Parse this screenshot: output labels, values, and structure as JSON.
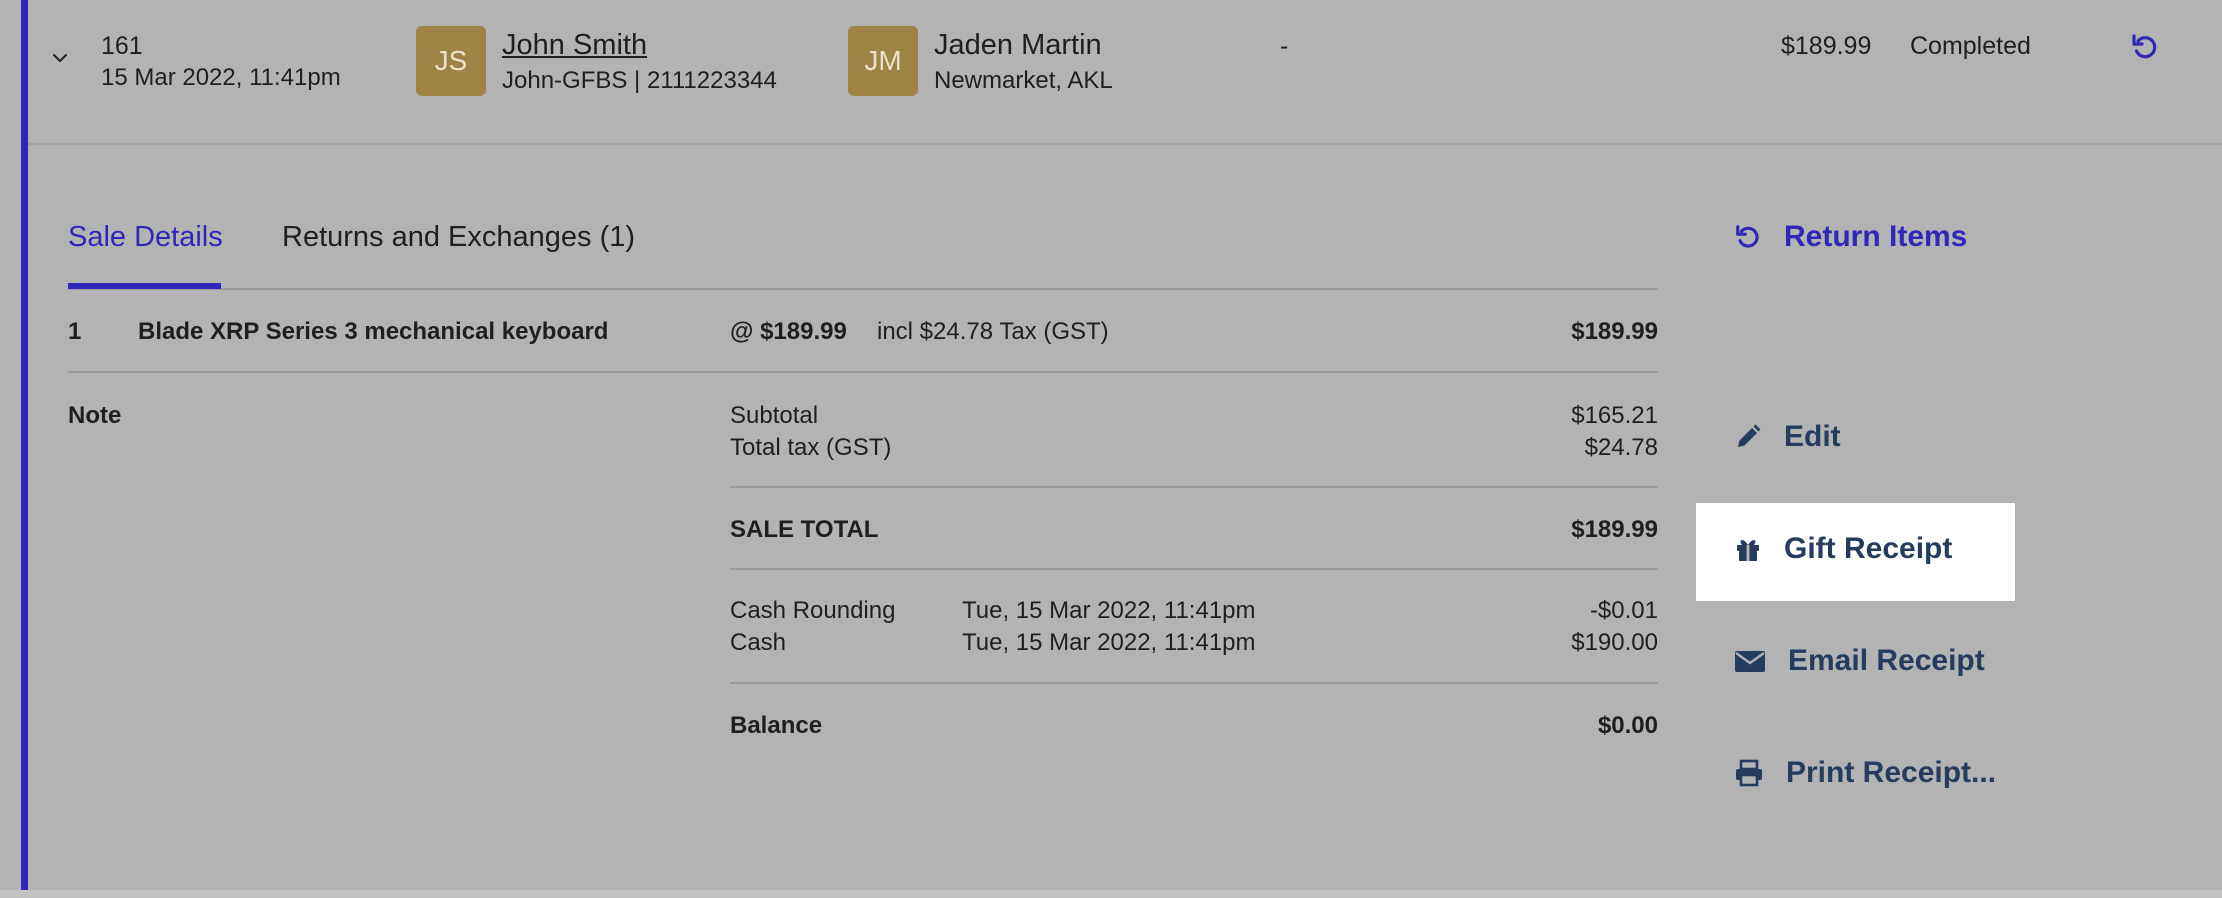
{
  "row": {
    "sale_number": "161",
    "sale_date": "15 Mar 2022, 11:41pm",
    "customer": {
      "initials": "JS",
      "name": "John Smith",
      "sub": "John-GFBS | 2111223344"
    },
    "staff": {
      "initials": "JM",
      "name": "Jaden Martin",
      "sub": "Newmarket, AKL"
    },
    "note_dash": "-",
    "amount": "$189.99",
    "status": "Completed"
  },
  "tabs": [
    {
      "label": "Sale Details",
      "active": true
    },
    {
      "label": "Returns and Exchanges (1)",
      "active": false
    }
  ],
  "line_item": {
    "qty": "1",
    "name": "Blade XRP Series 3 mechanical keyboard",
    "unit_price": "@ $189.99",
    "tax_note": "incl $24.78 Tax (GST)",
    "total": "$189.99"
  },
  "note_label": "Note",
  "totals": {
    "subtotal_label": "Subtotal",
    "subtotal": "$165.21",
    "tax_label": "Total tax (GST)",
    "tax": "$24.78",
    "sale_total_label": "SALE TOTAL",
    "sale_total": "$189.99"
  },
  "payments": [
    {
      "method": "Cash Rounding",
      "date": "Tue, 15 Mar 2022, 11:41pm",
      "amount": "-$0.01"
    },
    {
      "method": "Cash",
      "date": "Tue, 15 Mar 2022, 11:41pm",
      "amount": "$190.00"
    }
  ],
  "balance": {
    "label": "Balance",
    "amount": "$0.00"
  },
  "actions": {
    "return_items": "Return Items",
    "edit": "Edit",
    "gift_receipt": "Gift Receipt",
    "email_receipt": "Email Receipt",
    "print_receipt": "Print Receipt..."
  },
  "icons": {
    "row_toggle": "chevron-down-icon",
    "row_return": "return-icon",
    "return_items": "return-icon",
    "edit": "pencil-icon",
    "gift_receipt": "gift-icon",
    "email_receipt": "envelope-icon",
    "print_receipt": "printer-icon"
  },
  "colors": {
    "accent": "#2f27b8",
    "action_text": "#253c5e",
    "avatar": "#9f8346",
    "background": "#b3b3b3",
    "highlight": "#ffffff"
  }
}
